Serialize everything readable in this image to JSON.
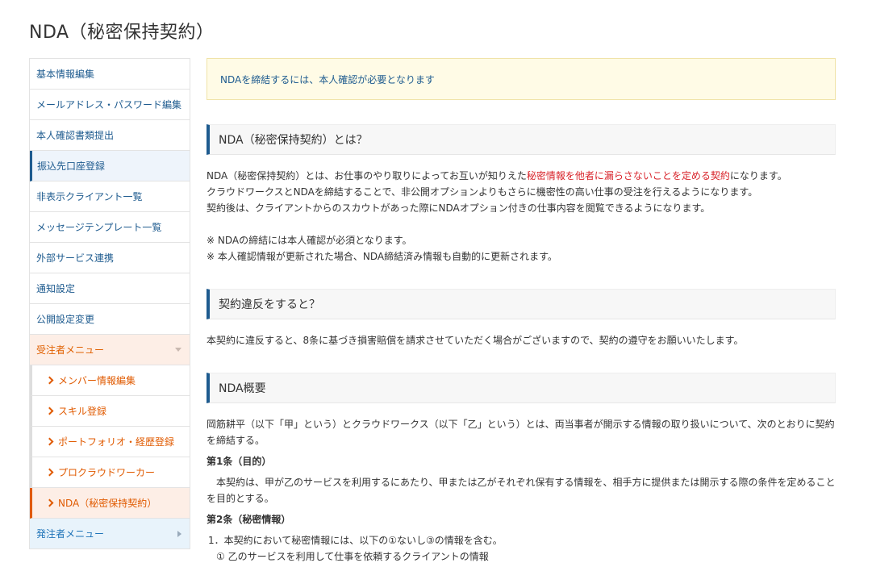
{
  "page": {
    "title": "NDA（秘密保持契約）"
  },
  "sidebar": {
    "items": [
      "基本情報編集",
      "メールアドレス・パスワード編集",
      "本人確認書類提出",
      "振込先口座登録",
      "非表示クライアント一覧",
      "メッセージテンプレート一覧",
      "外部サービス連携",
      "通知設定",
      "公開設定変更"
    ],
    "contractor_menu": {
      "label": "受注者メニュー",
      "items": [
        "メンバー情報編集",
        "スキル登録",
        "ポートフォリオ・経歴登録",
        "プロクラウドワーカー",
        "NDA（秘密保持契約）"
      ]
    },
    "client_menu": {
      "label": "発注者メニュー"
    }
  },
  "notice": "NDAを締結するには、本人確認が必要となります",
  "section1": {
    "heading": "NDA（秘密保持契約）とは？",
    "line1_pre": "NDA（秘密保持契約）とは、お仕事のやり取りによってお互いが知りえた",
    "line1_red": "秘密情報を他者に漏らさないことを定める契約",
    "line1_post": "になります。",
    "line2": "クラウドワークスとNDAを締結することで、非公開オプションよりもさらに機密性の高い仕事の受注を行えるようになります。",
    "line3": "契約後は、クライアントからのスカウトがあった際にNDAオプション付きの仕事内容を閲覧できるようになります。",
    "note1": "※ NDAの締結には本人確認が必須となります。",
    "note2": "※ 本人確認情報が更新された場合、NDA締結済み情報も自動的に更新されます。"
  },
  "section2": {
    "heading": "契約違反をすると？",
    "text": "本契約に違反すると、8条に基づき損害賠償を請求させていただく場合がございますので、契約の遵守をお願いいたします。"
  },
  "section3": {
    "heading": "NDA概要",
    "intro": "岡筋耕平（以下「甲」という）とクラウドワークス（以下「乙」という）とは、両当事者が開示する情報の取り扱いについて、次のとおりに契約を締結する。",
    "art1_title": "第1条（目的）",
    "art1_text": "本契約は、甲が乙のサービスを利用するにあたり、甲または乙がそれぞれ保有する情報を、相手方に提供または開示する際の条件を定めることを目的とする。",
    "art2_title": "第2条（秘密情報）",
    "art2_line1": "1．本契約において秘密情報には、以下の①ないし③の情報を含む。",
    "art2_line2": "① 乙のサービスを利用して仕事を依頼するクライアントの情報"
  }
}
